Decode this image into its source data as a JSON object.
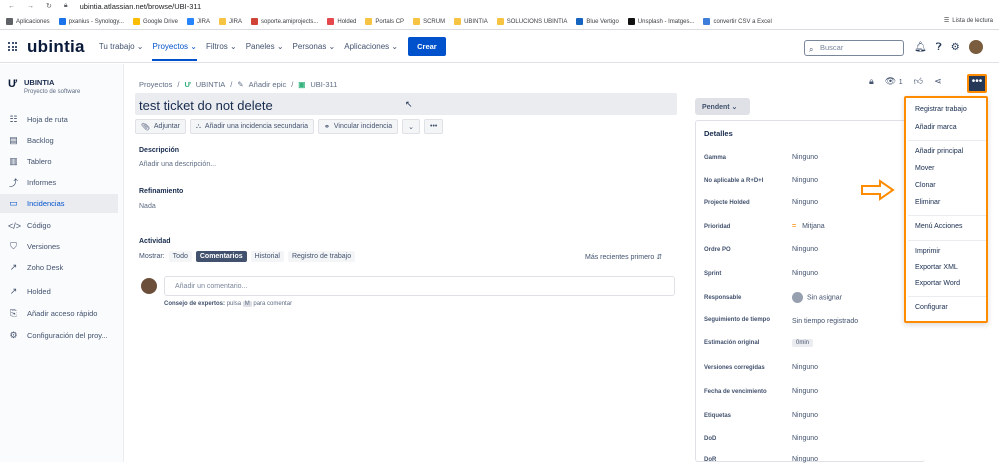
{
  "browser": {
    "url": "ubintia.atlassian.net/browse/UBI-311",
    "bookmarks": [
      "Aplicaciones",
      "pxanius - Synology...",
      "Google Drive",
      "JIRA",
      "JIRA",
      "soporte.amiprojects...",
      "Holded",
      "Portals CP",
      "SCRUM",
      "UBINTIA",
      "SOLUCIONS UBINTIA",
      "Blue Vertigo",
      "Unsplash - Imatges...",
      "convertir CSV a Excel"
    ],
    "reading_list": "Lista de lectura"
  },
  "topnav": {
    "logo": "ubintia",
    "items": [
      "Tu trabajo ⌄",
      "Proyectos ⌄",
      "Filtros ⌄",
      "Paneles ⌄",
      "Personas ⌄",
      "Aplicaciones ⌄"
    ],
    "active_index": 1,
    "create_label": "Crear",
    "search_placeholder": "Buscar"
  },
  "sidebar": {
    "project_name": "UBINTIA",
    "project_type": "Proyecto de software",
    "items": [
      {
        "label": "Hoja de ruta",
        "icon": "roadmap-icon"
      },
      {
        "label": "Backlog",
        "icon": "backlog-icon"
      },
      {
        "label": "Tablero",
        "icon": "board-icon"
      },
      {
        "label": "Informes",
        "icon": "reports-icon"
      },
      {
        "label": "Incidencias",
        "icon": "issues-icon"
      },
      {
        "label": "Código",
        "icon": "code-icon"
      },
      {
        "label": "Versiones",
        "icon": "releases-icon"
      },
      {
        "label": "Zoho Desk",
        "icon": "external-link-icon"
      },
      {
        "label": "Holded",
        "icon": "external-link-icon"
      },
      {
        "label": "Añadir acceso rápido",
        "icon": "add-shortcut-icon"
      },
      {
        "label": "Configuración del proy...",
        "icon": "gear-icon"
      }
    ],
    "selected_index": 4
  },
  "issue": {
    "breadcrumbs": [
      "Proyectos",
      "/",
      "UBINTIA",
      "/",
      "Añadir epic",
      "/",
      "UBI-311"
    ],
    "title": "test ticket do not delete",
    "actions": [
      "Adjuntar",
      "Añadir una incidencia secundaria",
      "Vincular incidencia",
      "⌄",
      "•••"
    ],
    "description_label": "Descripción",
    "description_placeholder": "Añadir una descripción...",
    "refinement_label": "Refinamiento",
    "refinement_value": "Nada",
    "activity_label": "Actividad",
    "show_label": "Mostrar:",
    "activity_tabs": [
      "Todo",
      "Comentarios",
      "Historial",
      "Registro de trabajo"
    ],
    "activity_active": 1,
    "sort_label": "Más recientes primero ⇵",
    "comment_placeholder": "Añadir un comentario...",
    "tip_prefix": "Consejo de expertos:",
    "tip_mid": "pulsa",
    "tip_key": "M",
    "tip_suffix": "para comentar",
    "watchers_count": "1"
  },
  "details": {
    "status": "Pendent ⌄",
    "heading": "Detalles",
    "rows": [
      {
        "label": "Gamma",
        "value": "Ninguno"
      },
      {
        "label": "No aplicable a R+D+I",
        "value": "Ninguno"
      },
      {
        "label": "Projecte Holded",
        "value": "Ninguno"
      },
      {
        "label": "Prioridad",
        "value": "Mitjana"
      },
      {
        "label": "Ordre PO",
        "value": "Ninguno"
      },
      {
        "label": "Sprint",
        "value": "Ninguno"
      },
      {
        "label": "Responsable",
        "value": "Sin asignar"
      },
      {
        "label": "Seguimiento de tiempo",
        "value": "Sin tiempo registrado"
      },
      {
        "label": "Estimación original",
        "value": "0min"
      },
      {
        "label": "Versiones corregidas",
        "value": "Ninguno"
      },
      {
        "label": "Fecha de vencimiento",
        "value": "Ninguno"
      },
      {
        "label": "Etiquetas",
        "value": "Ninguno"
      },
      {
        "label": "DoD",
        "value": "Ninguno"
      },
      {
        "label": "DoR",
        "value": "Ninguno"
      }
    ]
  },
  "more_menu": {
    "items": [
      "Registrar trabajo",
      "Añadir marca",
      "Añadir principal",
      "Mover",
      "Clonar",
      "Eliminar",
      "Menú Acciones",
      "Imprimir",
      "Exportar XML",
      "Exportar Word",
      "Configurar"
    ]
  },
  "colors": {
    "accent": "#0052cc",
    "highlight": "#ff8b00"
  }
}
